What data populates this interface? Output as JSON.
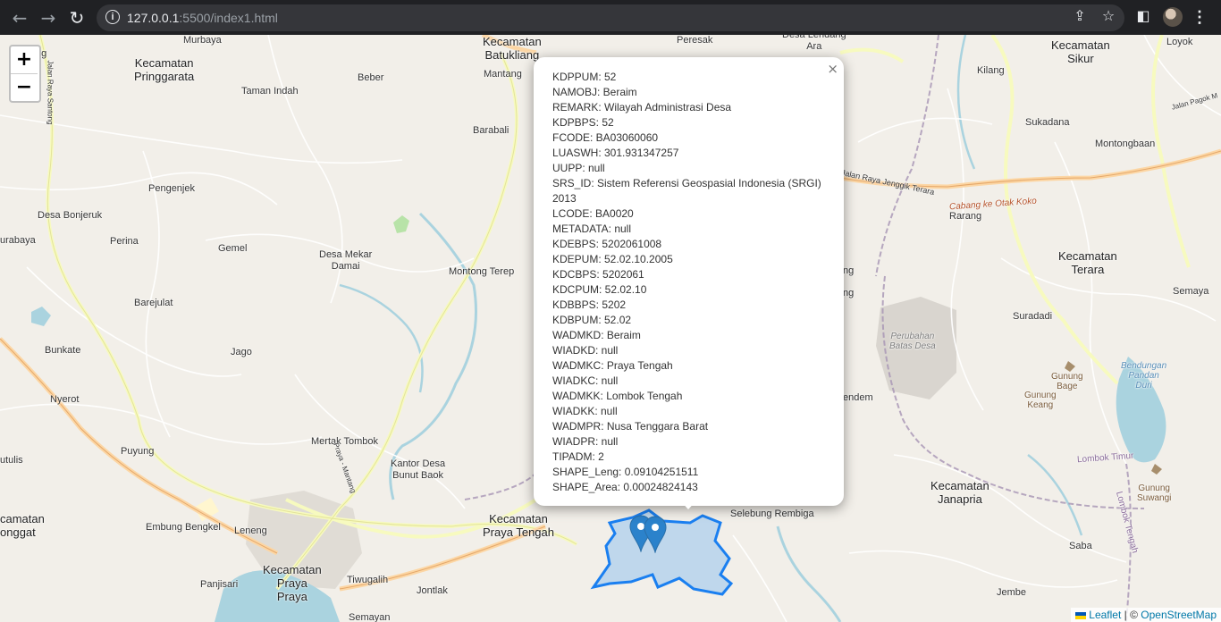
{
  "browser": {
    "url_host": "127.0.0.1",
    "url_rest": ":5500/index1.html"
  },
  "map": {
    "zoom_in_label": "+",
    "zoom_out_label": "−",
    "labels": {
      "murbaya": "Murbaya",
      "kec_pringgarata": "Kecamatan\nPringgarata",
      "taman_indah": "Taman Indah",
      "beber": "Beber",
      "kec_batukliang": "Kecamatan\nBatukliang",
      "mantang": "Mantang",
      "peresak": "Peresak",
      "desa_lendang_ara": "Desa Lendang\nAra",
      "kec_sikur": "Kecamatan\nSikur",
      "loyok": "Loyok",
      "kilang": "Kilang",
      "sukadana": "Sukadana",
      "montongbaan": "Montongbaan",
      "barabali": "Barabali",
      "pengenjek": "Pengenjek",
      "desa_bonjeruk": "Desa Bonjeruk",
      "urabaya": "urabaya",
      "perina": "Perina",
      "gemel": "Gemel",
      "desa_mekar_damai": "Desa Mekar\nDamai",
      "montong_terep": "Montong Terep",
      "rarang": "Rarang",
      "kec_terara": "Kecamatan\nTerara",
      "semaya": "Semaya",
      "suradadi": "Suradadi",
      "barejulat": "Barejulat",
      "bunkate": "Bunkate",
      "jago": "Jago",
      "nyerot": "Nyerot",
      "mertak_tombok": "Mertak Tombok",
      "puyung": "Puyung",
      "utulis": "utulis",
      "kantor_desa": "Kantor Desa\nBunut Baok",
      "kec_onggat": "camatan\nonggat",
      "embung_bengkel": "Embung Bengkel",
      "leneng": "Leneng",
      "kec_praya_tengah": "Kecamatan\nPraya Tengah",
      "selebung_rembiga": "Selebung Rembiga",
      "kec_janapria": "Kecamatan\nJanapria",
      "kec_praya": "Kecamatan\nPraya\nPraya",
      "tiwugalih": "Tiwugalih",
      "panjisari": "Panjisari",
      "jontlak": "Jontlak",
      "semayan": "Semayan",
      "saba": "Saba",
      "jembe": "Jembe",
      "gunung_bage": "Gunung\nBage",
      "gunung_keang": "Gunung\nKeang",
      "gunung_suwangi": "Gunung\nSuwangi",
      "bendungan": "Bendungan\nPandan\nDuri",
      "perubahan": "Perubahan\nBatas Desa",
      "cabang": "Cabang ke Otak Koko",
      "jalan_raya_jenggik": "Jalan Raya Jenggik Terara",
      "lombok_timur": "Lombok Timur",
      "lombok_tengah": "Lombok Tengah",
      "jalan_raya_santong": "Jalan Raya Santong",
      "jalan_pagok": "Jalan Pagok M",
      "praya_mantang": "Praya - Mantang",
      "frag_ng1": "ng",
      "frag_ng2": "ng",
      "frag_dem": "endem",
      "frag_ng_left": "ng"
    }
  },
  "popup": {
    "close_label": "×",
    "fields": [
      "KDPPUM: 52",
      "NAMOBJ: Beraim",
      "REMARK: Wilayah Administrasi Desa",
      "KDPBPS: 52",
      "FCODE: BA03060060",
      "LUASWH: 301.931347257",
      "UUPP: null",
      "SRS_ID: Sistem Referensi Geospasial Indonesia (SRGI) 2013",
      "LCODE: BA0020",
      "METADATA: null",
      "KDEBPS: 5202061008",
      "KDEPUM: 52.02.10.2005",
      "KDCBPS: 5202061",
      "KDCPUM: 52.02.10",
      "KDBBPS: 5202",
      "KDBPUM: 52.02",
      "WADMKD: Beraim",
      "WIADKD: null",
      "WADMKC: Praya Tengah",
      "WIADKC: null",
      "WADMKK: Lombok Tengah",
      "WIADKK: null",
      "WADMPR: Nusa Tenggara Barat",
      "WIADPR: null",
      "TIPADM: 2",
      "SHAPE_Leng: 0.09104251511",
      "SHAPE_Area: 0.00024824143"
    ]
  },
  "attribution": {
    "leaflet": "Leaflet",
    "separator": " | © ",
    "osm": "OpenStreetMap"
  },
  "colors": {
    "polygon_stroke": "#1a7ff0",
    "polygon_fill": "#9cc6ee",
    "marker": "#2b82cb"
  }
}
